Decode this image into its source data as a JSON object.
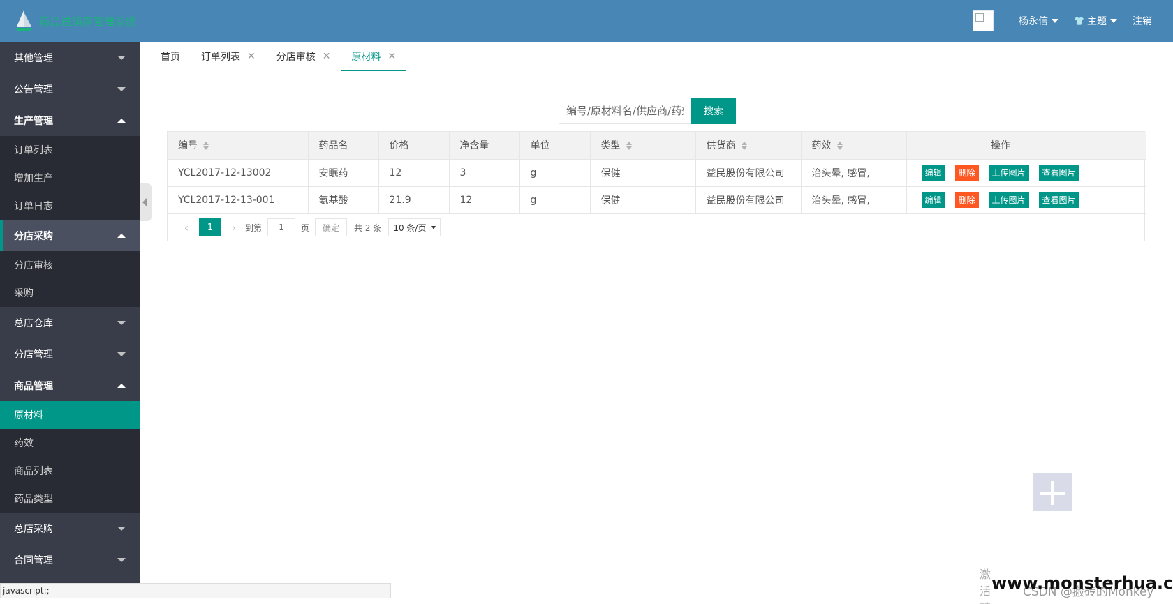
{
  "header": {
    "logo_text": "药品进销存管理系统",
    "username": "杨永信",
    "theme_label": "主题",
    "logout_label": "注销"
  },
  "sidebar": {
    "groups": [
      {
        "label": "其他管理",
        "open": false
      },
      {
        "label": "公告管理",
        "open": false
      },
      {
        "label": "生产管理",
        "open": true,
        "items": [
          "订单列表",
          "增加生产",
          "订单日志"
        ]
      },
      {
        "label": "分店采购",
        "open": true,
        "items": [
          "分店审核",
          "采购"
        ]
      },
      {
        "label": "总店仓库",
        "open": false
      },
      {
        "label": "分店管理",
        "open": false
      },
      {
        "label": "商品管理",
        "open": true,
        "items": [
          "原材料",
          "药效",
          "商品列表",
          "药品类型"
        ]
      },
      {
        "label": "总店采购",
        "open": false
      },
      {
        "label": "合同管理",
        "open": false
      }
    ],
    "active_item": "原材料"
  },
  "tabs": [
    {
      "label": "首页",
      "closable": false
    },
    {
      "label": "订单列表",
      "closable": true
    },
    {
      "label": "分店审核",
      "closable": true
    },
    {
      "label": "原材料",
      "closable": true,
      "active": true
    }
  ],
  "search": {
    "placeholder": "编号/原材料名/供应商/药效",
    "button_label": "搜索"
  },
  "table": {
    "columns": [
      "编号",
      "药品名",
      "价格",
      "净含量",
      "单位",
      "类型",
      "供货商",
      "药效",
      "操作"
    ],
    "rows": [
      [
        "YCL2017-12-13002",
        "安眠药",
        "12",
        "3",
        "g",
        "保健",
        "益民股份有限公司",
        "治头晕, 感冒,"
      ],
      [
        "YCL2017-12-13-001",
        "氨基酸",
        "21.9",
        "12",
        "g",
        "保健",
        "益民股份有限公司",
        "治头晕, 感冒,"
      ]
    ],
    "actions": [
      "编辑",
      "删除",
      "上传图片",
      "查看图片"
    ]
  },
  "pager": {
    "prev": "‹",
    "current": "1",
    "next": "›",
    "goto_label": "到第",
    "goto_value": "1",
    "page_label": "页",
    "confirm_label": "确定",
    "total_label": "共 2 条",
    "page_size": "10 条/页"
  },
  "status_bar": "javascript:;",
  "side_text": "激活转",
  "watermark": "www.monsterhua.com",
  "watermark_sub": "CSDN @搬砖的Monkey"
}
